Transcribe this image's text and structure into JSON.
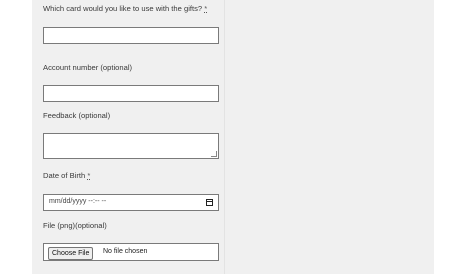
{
  "form": {
    "card_question": {
      "label": "Which card would you like to use with the gifts?",
      "required_mark": "*",
      "value": ""
    },
    "account_number": {
      "label": "Account number (optional)",
      "value": ""
    },
    "feedback": {
      "label": "Feedback (optional)",
      "value": ""
    },
    "dob": {
      "label": "Date of Birth",
      "required_mark": "*",
      "placeholder": "mm/dd/yyyy --:-- --"
    },
    "file": {
      "label": "File (png)(optional)",
      "button_label": "Choose File",
      "status": "No file chosen"
    }
  },
  "icons": {
    "calendar": "calendar-icon"
  },
  "colors": {
    "panel_background": "#f0f0f0",
    "field_border": "#7a7a7a",
    "label_text": "#3a3a3a"
  }
}
